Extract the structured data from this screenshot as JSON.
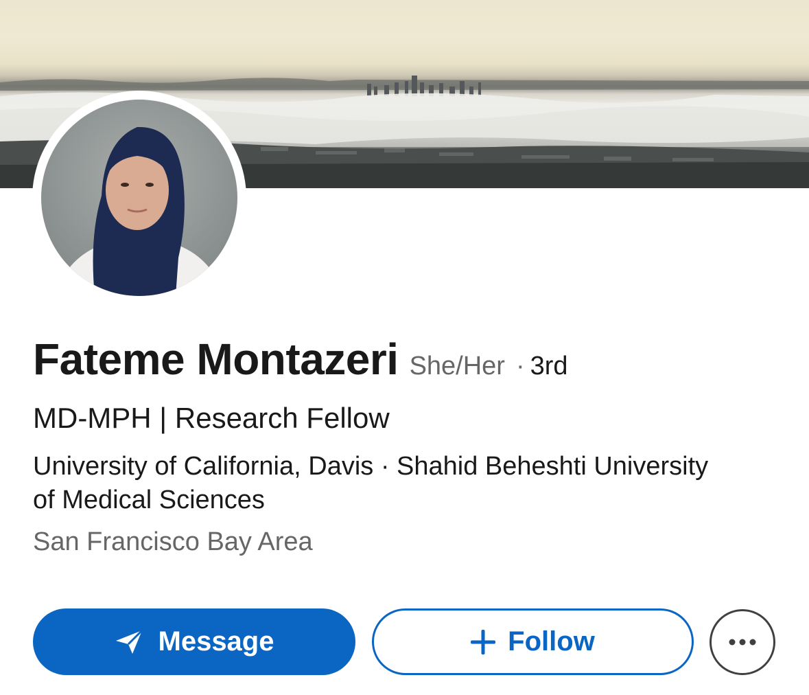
{
  "profile": {
    "name": "Fateme Montazeri",
    "pronouns": "She/Her",
    "separator": "·",
    "connection_degree": "3rd",
    "headline": "MD-MPH | Research Fellow",
    "education": "University of California, Davis · Shahid Beheshti University of Medical Sciences",
    "location": "San Francisco Bay Area"
  },
  "actions": {
    "message_label": "Message",
    "message_icon": "paper-plane-icon",
    "follow_label": "Follow",
    "follow_icon": "plus-icon",
    "more_icon": "more-horizontal-icon"
  },
  "colors": {
    "primary_blue": "#0a66c2",
    "text_primary": "#191919",
    "text_secondary": "#666666"
  }
}
